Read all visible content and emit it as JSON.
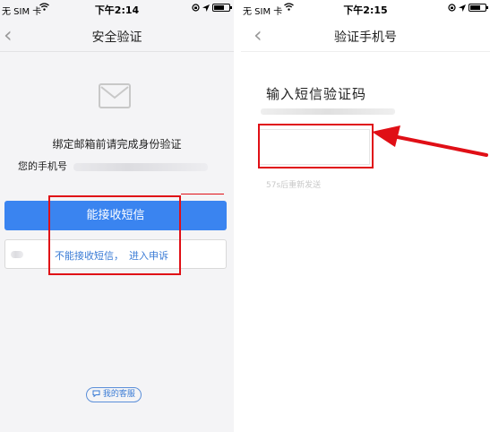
{
  "left": {
    "status": {
      "carrier": "无 SIM 卡",
      "time": "下午2:14"
    },
    "nav": {
      "back_glyph": "‹",
      "title": "安全验证"
    },
    "icon": "mail-icon",
    "bind_text": "绑定邮箱前请完成身份验证",
    "phone_prefix": "您的手机号",
    "primary_button": "能接收短信",
    "secondary_text": "不能接收短信，",
    "appeal_link": "进入申诉",
    "service_button": "我的客服"
  },
  "right": {
    "status": {
      "carrier": "无 SIM 卡",
      "time": "下午2:15"
    },
    "nav": {
      "back_glyph": "‹",
      "title": "验证手机号"
    },
    "input_label": "输入短信验证码",
    "resend_text": "57s后重新发送"
  },
  "colors": {
    "primary": "#3a84f0",
    "link": "#3a7bd5",
    "annotation": "#e00f16"
  }
}
